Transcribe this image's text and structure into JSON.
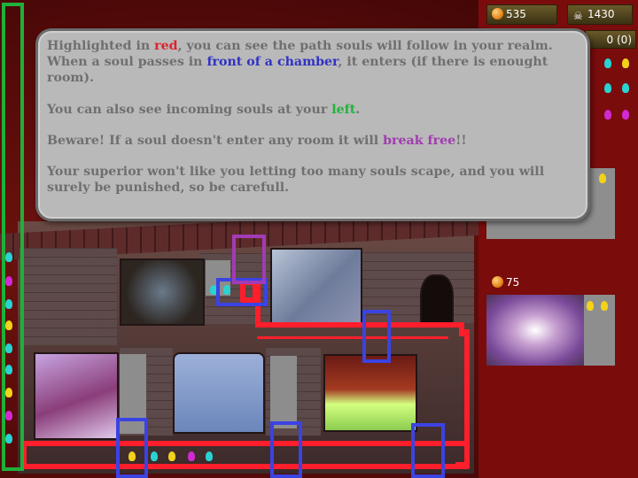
{
  "hud": {
    "gold": "535",
    "kills": "1430",
    "escaped": "0 (0)"
  },
  "sidebar": {
    "card_cost": "75"
  },
  "tutorial": {
    "p1_a": "Highlighted in ",
    "p1_red": "red",
    "p1_b": ", you can see the path souls will follow in your realm. When a soul passes in ",
    "p1_blue": "front of a chamber",
    "p1_c": ", it enters (if there is enought room).",
    "p2_a": "You can also see incoming souls at your ",
    "p2_green": "left",
    "p2_b": ".",
    "p3_a": "Beware! If a soul doesn't enter any room it will ",
    "p3_purple": "break free",
    "p3_b": "!!",
    "p4": "Your superior won't like you letting too many souls scape, and you will surely be punished, so be carefull."
  },
  "colors": {
    "path_red": "#ff1e2c",
    "chamber_entry_blue": "#3b43e2",
    "incoming_green": "#1fb03a",
    "escape_purple": "#a23bb5",
    "dialog_bg": "#b9b9b9",
    "dialog_text": "#6f6f6f"
  },
  "icons": {
    "gold": "coin-icon",
    "kills": "skull-icon",
    "souls": "soul-icon"
  }
}
